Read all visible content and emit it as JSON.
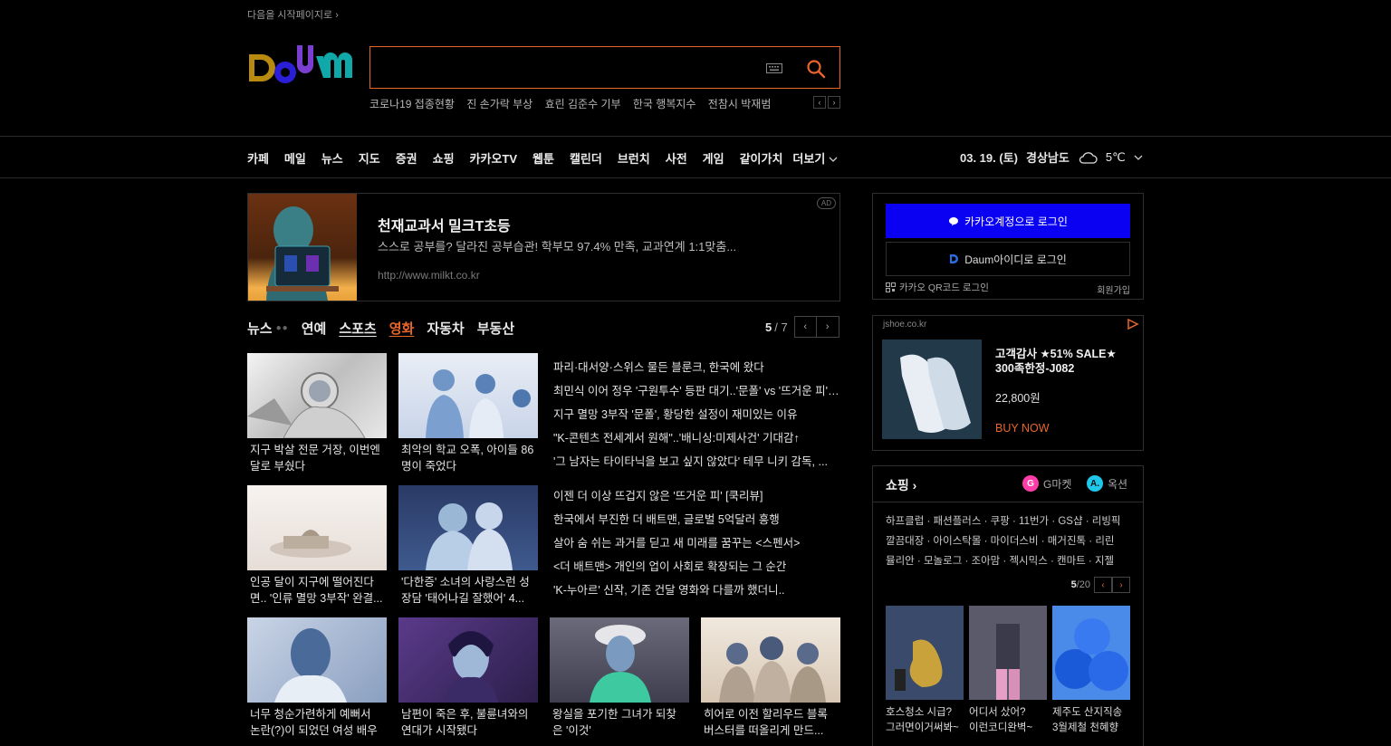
{
  "header": {
    "start_page_link": "다음을 시작페이지로 ›",
    "search_placeholder": "",
    "trends": [
      "코로나19 접종현황",
      "진 손가락 부상",
      "효린 김준수 기부",
      "한국 행복지수",
      "전참시 박재범"
    ]
  },
  "nav": {
    "items": [
      "카페",
      "메일",
      "뉴스",
      "지도",
      "증권",
      "쇼핑",
      "카카오TV",
      "웹툰",
      "캘린더",
      "브런치",
      "사전",
      "게임",
      "같이가치"
    ],
    "more": "더보기",
    "date": "03. 19. (토)",
    "region": "경상남도",
    "temp": "5℃"
  },
  "ad": {
    "title": "천재교과서 밀크T초등",
    "desc": "스스로 공부를? 달라진 공부습관! 학부모 97.4% 만족, 교과연계 1:1맞춤...",
    "url": "http://www.milkt.co.kr",
    "badge": "AD"
  },
  "news": {
    "tabs": [
      "뉴스",
      "연예",
      "스포츠",
      "영화",
      "자동차",
      "부동산"
    ],
    "active_tab": "영화",
    "page_current": "5",
    "page_total": "/ 7",
    "thumbs_row1": [
      {
        "l1": "지구 박살 전문 거장, 이번엔",
        "l2": "달로 부쉈다"
      },
      {
        "l1": "최악의 학교 오폭, 아이들 86",
        "l2": "명이 죽었다"
      }
    ],
    "thumbs_row2": [
      {
        "l1": "인공 달이 지구에 떨어진다",
        "l2": "면.. '인류 멸망 3부작' 완결..."
      },
      {
        "l1": "'다한증' 소녀의 사랑스런 성",
        "l2": "장담 '태어나길 잘했어' 4..."
      }
    ],
    "headlines1": [
      "파리·대서양·스위스 물든 블룬크, 한국에 왔다",
      "최민식 이어 정우 '구원투수' 등판 대기..'문폴' vs '뜨거운 피' ...",
      "지구 멸망 3부작 '문폴', 황당한 설정이 재미있는 이유",
      "\"K-콘텐츠 전세계서 원해\"..'배니싱:미제사건' 기대감↑",
      "'그 남자는 타이타닉을 보고 싶지 않았다' 테무 니키 감독, ..."
    ],
    "headlines2": [
      "이젠 더 이상 뜨겁지 않은 '뜨거운 피' [쿡리뷰]",
      "한국에서 부진한 더 배트맨, 글로벌 5억달러 흥행",
      "살아 숨 쉬는 과거를 딛고 새 미래를 꿈꾸는 <스펜서>",
      "<더 배트맨> 개인의 업이 사회로 확장되는 그 순간",
      "'K-누아르' 신작, 기존 건달 영화와 다를까 했더니.."
    ],
    "thumbs_row3": [
      {
        "l1": "너무 청순가련하게 예뻐서",
        "l2": "논란(?)이 되었던 여성 배우"
      },
      {
        "l1": "남편이 죽은 후, 불륜녀와의",
        "l2": "연대가 시작됐다"
      },
      {
        "l1": "왕실을 포기한 그녀가 되찾",
        "l2": "은 '이것'"
      },
      {
        "l1": "히어로 이전 할리우드 블록",
        "l2": "버스터를 떠올리게 만드..."
      }
    ]
  },
  "login": {
    "kakao_label": "카카오계정으로 로그인",
    "daum_label": "Daum아이디로 로그인",
    "qr_label": "카카오 QR코드 로그인",
    "join_label": "회원가입"
  },
  "shop_ad": {
    "domain": "jshoe.co.kr",
    "title": "고객감사 ★51% SALE★ 300족한정-J082",
    "price": "22,800원",
    "buy": "BUY NOW"
  },
  "shopping": {
    "title": "쇼핑 ›",
    "gmarket": "G마켓",
    "auction": "옥션",
    "links": [
      "하프클럽 · 패션플러스 · 쿠팡 · 11번가 · GS샵 · 리빙픽",
      "깔끔대장 · 아이스탁몰 · 마이더스비 · 매거진톡 · 리린",
      "뮬리안 · 모놀로그 · 조아맘 · 젝시믹스 · 캔마트 · 지젤"
    ],
    "page_current": "5",
    "page_total": "/20",
    "products": [
      {
        "l1": "호스청소 시급?",
        "l2": "그러면이거써봐~"
      },
      {
        "l1": "어디서 샀어?",
        "l2": "이런코디완벽~"
      },
      {
        "l1": "제주도 산지직송",
        "l2": "3월제철 천혜향"
      }
    ]
  },
  "colors": {
    "accent": "#e8662c",
    "kakao_blue": "#0a00f2"
  }
}
